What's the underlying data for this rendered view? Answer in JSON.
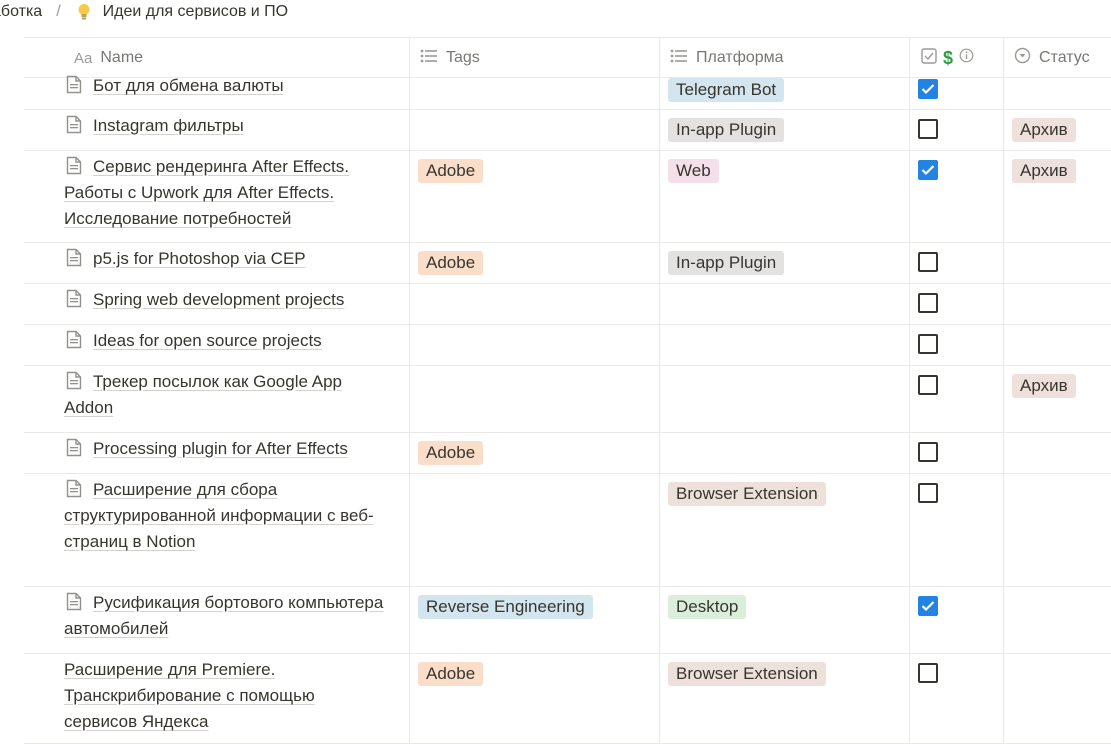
{
  "breadcrumb": {
    "parent": "аботка",
    "separator": "/",
    "page_icon": "lightbulb-icon",
    "page_title": "Идеи для сервисов и ПО"
  },
  "columns": {
    "name": {
      "type_icon": "Aa",
      "label": "Name"
    },
    "tags": {
      "type_icon": "list-icon",
      "label": "Tags"
    },
    "platform": {
      "type_icon": "list-icon",
      "label": "Платформа"
    },
    "paid": {
      "type_icon": "checkbox-icon",
      "emoji": "$",
      "info_icon": "info-icon"
    },
    "status": {
      "type_icon": "select-icon",
      "label": "Статус"
    }
  },
  "colors": {
    "tag_orange": "#fadec9",
    "tag_blue": "#d3e5ef",
    "tag_gray": "#e3e2e0",
    "tag_pink": "#f5e0e9",
    "tag_brown": "#eee0da",
    "tag_green": "#dbeddb",
    "checkbox_on": "#2383e2",
    "gridline": "#e9e9e7"
  },
  "rows": [
    {
      "lines": [
        "Бот для обмена валюты"
      ],
      "icon": true,
      "tag": "",
      "tag_color": "",
      "platform": "Telegram Bot",
      "platform_color": "tag_blue",
      "checked": true,
      "status": ""
    },
    {
      "lines": [
        "Instagram фильтры"
      ],
      "icon": true,
      "tag": "",
      "tag_color": "",
      "platform": "In-app Plugin",
      "platform_color": "tag_gray",
      "checked": false,
      "status": "Архив"
    },
    {
      "lines": [
        "Сервис рендеринга After Effects.",
        "Работы с Upwork для After Effects.",
        "Исследование потребностей"
      ],
      "icon": true,
      "tag": "Adobe",
      "tag_color": "tag_orange",
      "platform": "Web",
      "platform_color": "tag_pink",
      "checked": true,
      "status": "Архив"
    },
    {
      "lines": [
        "p5.js for Photoshop via CEP"
      ],
      "icon": true,
      "tag": "Adobe",
      "tag_color": "tag_orange",
      "platform": "In-app Plugin",
      "platform_color": "tag_gray",
      "checked": false,
      "status": ""
    },
    {
      "lines": [
        "Spring web development projects"
      ],
      "icon": true,
      "tag": "",
      "tag_color": "",
      "platform": "",
      "platform_color": "",
      "checked": false,
      "status": ""
    },
    {
      "lines": [
        "Ideas for open source projects"
      ],
      "icon": true,
      "tag": "",
      "tag_color": "",
      "platform": "",
      "platform_color": "",
      "checked": false,
      "status": ""
    },
    {
      "lines": [
        "Трекер посылок как Google App",
        "Addon"
      ],
      "icon": true,
      "tag": "",
      "tag_color": "",
      "platform": "",
      "platform_color": "",
      "checked": false,
      "status": "Архив"
    },
    {
      "lines": [
        "Processing plugin for After Effects"
      ],
      "icon": true,
      "tag": "Adobe",
      "tag_color": "tag_orange",
      "platform": "",
      "platform_color": "",
      "checked": false,
      "status": ""
    },
    {
      "lines": [
        "Расширение для сбора",
        "структурированной информации с веб-",
        "страниц в Notion"
      ],
      "icon": true,
      "tag": "",
      "tag_color": "",
      "platform": "Browser Extension",
      "platform_color": "tag_brown",
      "checked": false,
      "status": ""
    },
    {
      "lines": [
        "Русификация бортового компьютера",
        "автомобилей"
      ],
      "icon": true,
      "tag": "Reverse Engineering",
      "tag_color": "tag_blue",
      "platform": "Desktop",
      "platform_color": "tag_green",
      "checked": true,
      "status": ""
    },
    {
      "lines": [
        "Расширение для Premiere.",
        "Транскрибирование с помощью",
        "сервисов Яндекса"
      ],
      "icon": false,
      "tag": "Adobe",
      "tag_color": "tag_orange",
      "platform": "Browser Extension",
      "platform_color": "tag_brown",
      "checked": false,
      "status": ""
    }
  ]
}
